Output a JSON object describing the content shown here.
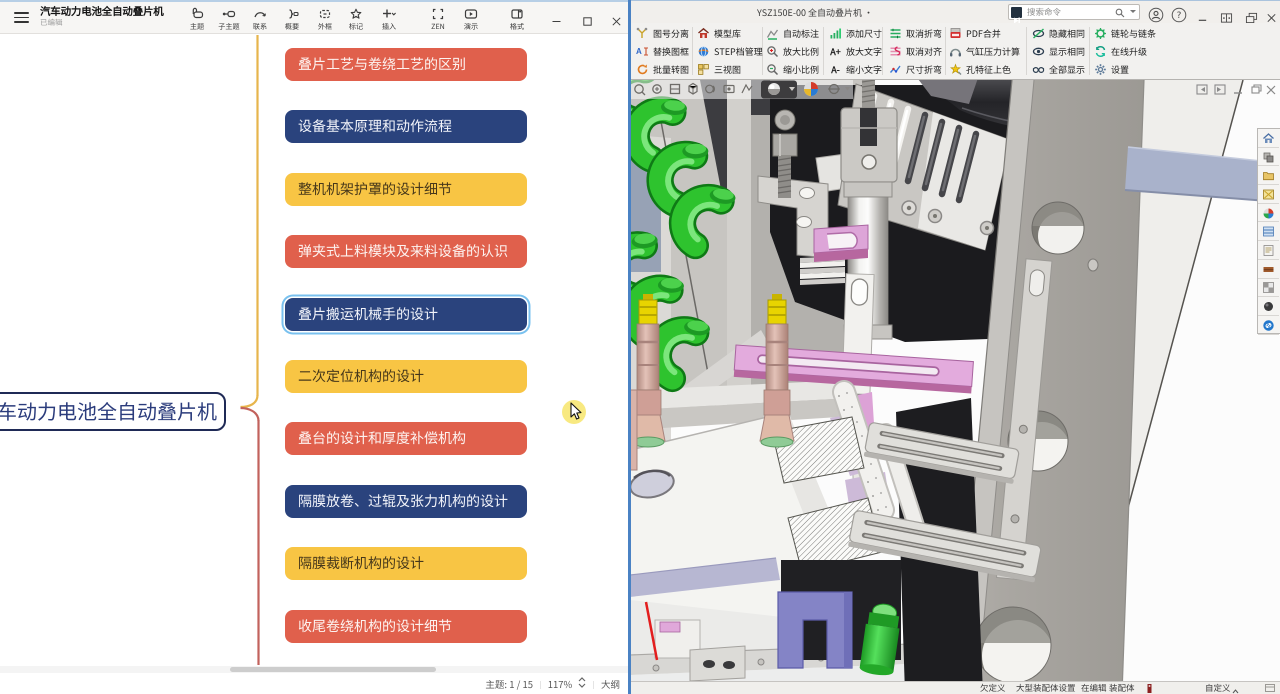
{
  "palette": {
    "node_red": "#e0604c",
    "node_navy": "#2a437d",
    "node_yellow": "#f8c544",
    "root_border_navy": "#1f2a56",
    "branch_yellow": "#e7b54c",
    "branch_red": "#c2625c",
    "selection_blue": "#79c1ef",
    "window_divider_blue": "#4a82c4"
  },
  "left_app": {
    "window_title": "汽车动力电池全自动叠片机",
    "window_subtitle": "已编辑",
    "toolbar": [
      {
        "label": "主题"
      },
      {
        "label": "子主题"
      },
      {
        "label": "联系"
      },
      {
        "label": "概要"
      },
      {
        "label": "外框"
      },
      {
        "label": "标记"
      },
      {
        "label": "插入"
      },
      {
        "label": "ZEN"
      },
      {
        "label": "演示"
      },
      {
        "label": "格式"
      }
    ],
    "mindmap": {
      "root_label": "汽车动力电池全自动叠片机",
      "topics": [
        {
          "label": "叠片工艺与卷绕工艺的区别",
          "color": "red"
        },
        {
          "label": "设备基本原理和动作流程",
          "color": "navy"
        },
        {
          "label": "整机机架护罩的设计细节",
          "color": "yellow"
        },
        {
          "label": "弹夹式上料模块及来料设备的认识",
          "color": "red"
        },
        {
          "label": "叠片搬运机械手的设计",
          "color": "navy",
          "selected": true
        },
        {
          "label": "二次定位机构的设计",
          "color": "yellow"
        },
        {
          "label": "叠台的设计和厚度补偿机构",
          "color": "red"
        },
        {
          "label": "隔膜放卷、过辊及张力机构的设计",
          "color": "navy"
        },
        {
          "label": "隔膜裁断机构的设计",
          "color": "yellow"
        },
        {
          "label": "收尾卷绕机构的设计细节",
          "color": "red"
        }
      ]
    },
    "statusbar": {
      "topic_counter": "主题: 1 / 15",
      "zoom_level": "117%",
      "outline_label": "大纲"
    }
  },
  "right_app": {
    "window_title": "YSZ150E-00 全自动叠片机 ·",
    "search_placeholder": "搜索命令",
    "ribbon_groups": [
      [
        "图号分离",
        "替换图框",
        "批量转图"
      ],
      [
        "模型库",
        "STEP档管理",
        "三视图"
      ],
      [
        "自动标注",
        "放大比例",
        "缩小比例"
      ],
      [
        "添加尺寸",
        "放大文字",
        "缩小文字"
      ],
      [
        "取消折弯",
        "取消对齐",
        "尺寸折弯"
      ],
      [
        "PDF合并",
        "气缸压力计算",
        "孔特征上色"
      ],
      [
        "隐藏相同",
        "显示相同",
        "全部显示"
      ],
      [
        "链轮与链条",
        "在线升级",
        "设置"
      ]
    ],
    "icon_texts": {
      "font_plus": "A+",
      "font_minus": "A-"
    },
    "statusbar": {
      "definition": "欠定义",
      "assembly_mode": "大型装配体设置",
      "editing": "在编辑",
      "doc_type": "装配体",
      "customize": "自定义"
    }
  }
}
